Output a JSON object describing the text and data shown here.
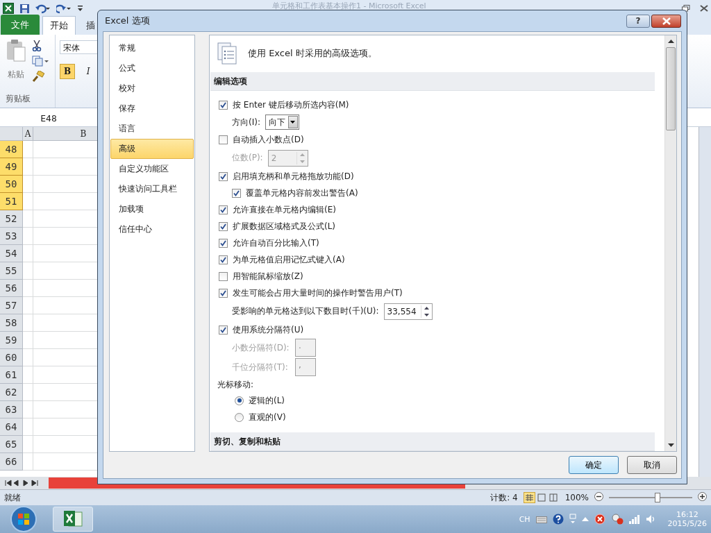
{
  "excel": {
    "title": "单元格和工作表基本操作1 - Microsoft Excel",
    "tabs": [
      {
        "label": "文件",
        "selected": false,
        "kind": "file"
      },
      {
        "label": "开始",
        "selected": true,
        "kind": "tab"
      },
      {
        "label": "插",
        "selected": false,
        "kind": "tab"
      }
    ],
    "paste": "粘贴",
    "clipboard_group": "剪贴板",
    "font": "宋体",
    "bold": {
      "label": "B",
      "on": true
    },
    "italic": {
      "label": "I",
      "on": false
    },
    "name_box": "E48",
    "columns": [
      "A",
      "B"
    ],
    "rows": [
      {
        "label": "48",
        "selected": true
      },
      {
        "label": "49",
        "selected": true
      },
      {
        "label": "50",
        "selected": true
      },
      {
        "label": "51",
        "selected": true
      },
      {
        "label": "52",
        "selected": false
      },
      {
        "label": "53",
        "selected": false
      },
      {
        "label": "54",
        "selected": false
      },
      {
        "label": "55",
        "selected": false
      },
      {
        "label": "56",
        "selected": false
      },
      {
        "label": "57",
        "selected": false
      },
      {
        "label": "58",
        "selected": false
      },
      {
        "label": "59",
        "selected": false
      },
      {
        "label": "60",
        "selected": false
      },
      {
        "label": "61",
        "selected": false
      },
      {
        "label": "62",
        "selected": false
      },
      {
        "label": "63",
        "selected": false
      },
      {
        "label": "64",
        "selected": false
      },
      {
        "label": "65",
        "selected": false
      },
      {
        "label": "66",
        "selected": false
      }
    ],
    "status": "就绪",
    "count": "计数: 4",
    "zoom": "100%",
    "zoom_slider": {
      "level": 0.58
    }
  },
  "taskbar": {
    "language": "CH",
    "time": "16:12",
    "date": "2015/5/26"
  },
  "dialog": {
    "title": "Excel 选项",
    "help": "?",
    "nav": [
      {
        "label": "常规",
        "selected": false
      },
      {
        "label": "公式",
        "selected": false
      },
      {
        "label": "校对",
        "selected": false
      },
      {
        "label": "保存",
        "selected": false
      },
      {
        "label": "语言",
        "selected": false
      },
      {
        "label": "高级",
        "selected": true
      },
      {
        "label": "自定义功能区",
        "selected": false
      },
      {
        "label": "快速访问工具栏",
        "selected": false
      },
      {
        "label": "加载项",
        "selected": false
      },
      {
        "label": "信任中心",
        "selected": false
      }
    ],
    "heading": "使用 Excel 时采用的高级选项。",
    "sections": [
      {
        "title": "编辑选项",
        "items": [
          {
            "kind": "checkbox",
            "label": "按 Enter 键后移动所选内容(M)",
            "checked": true,
            "children": [
              {
                "kind": "select",
                "label": "方向(I):",
                "value": "向下"
              }
            ]
          },
          {
            "kind": "checkbox",
            "label": "自动插入小数点(D)",
            "checked": false,
            "children": [
              {
                "kind": "spin",
                "label": "位数(P):",
                "value": "2",
                "disabled": true
              }
            ]
          },
          {
            "kind": "checkbox",
            "label": "启用填充柄和单元格拖放功能(D)",
            "checked": true,
            "children": [
              {
                "kind": "checkbox",
                "label": "覆盖单元格内容前发出警告(A)",
                "checked": true
              }
            ]
          },
          {
            "kind": "checkbox",
            "label": "允许直接在单元格内编辑(E)",
            "checked": true
          },
          {
            "kind": "checkbox",
            "label": "扩展数据区域格式及公式(L)",
            "checked": true
          },
          {
            "kind": "checkbox",
            "label": "允许自动百分比输入(T)",
            "checked": true
          },
          {
            "kind": "checkbox",
            "label": "为单元格值启用记忆式键入(A)",
            "checked": true
          },
          {
            "kind": "checkbox",
            "label": "用智能鼠标缩放(Z)",
            "checked": false
          },
          {
            "kind": "checkbox",
            "label": "发生可能会占用大量时间的操作时警告用户(T)",
            "checked": true,
            "children": [
              {
                "kind": "spin",
                "label": "受影响的单元格达到以下数目时(千)(U):",
                "value": "33,554",
                "disabled": false
              }
            ]
          },
          {
            "kind": "checkbox",
            "label": "使用系统分隔符(U)",
            "checked": true,
            "children": [
              {
                "kind": "text_field",
                "label": "小数分隔符(D):",
                "value": ".",
                "disabled": true
              },
              {
                "kind": "text_field",
                "label": "千位分隔符(T):",
                "value": ",",
                "disabled": true
              }
            ]
          },
          {
            "kind": "label",
            "label": "光标移动:",
            "children": [
              {
                "kind": "radio",
                "label": "逻辑的(L)",
                "selected": true
              },
              {
                "kind": "radio",
                "label": "直观的(V)",
                "selected": false
              }
            ]
          }
        ]
      },
      {
        "title": "剪切、复制和粘贴"
      }
    ],
    "buttons": [
      {
        "label": "确定",
        "default": true
      },
      {
        "label": "取消",
        "default": false
      }
    ]
  }
}
